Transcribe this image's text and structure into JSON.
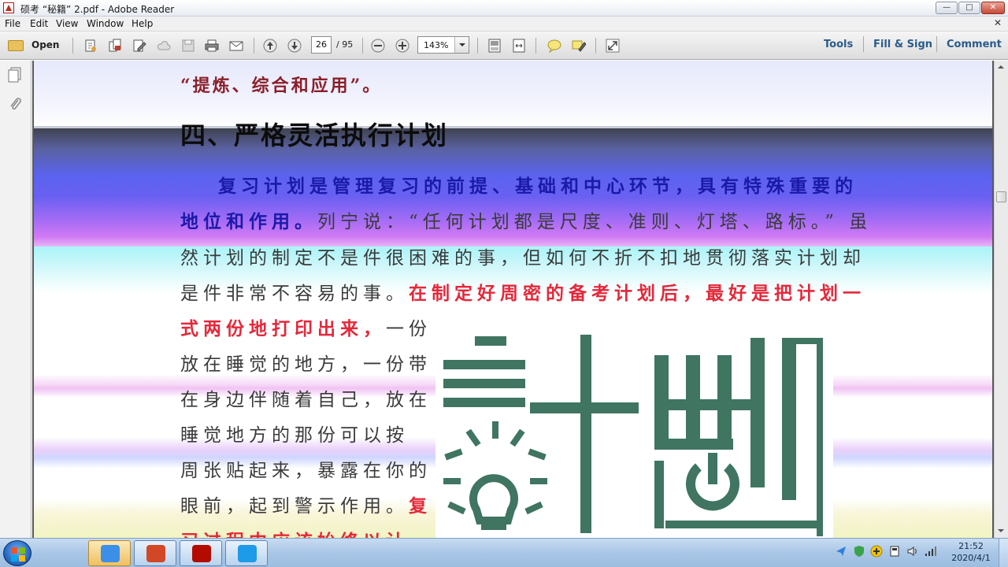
{
  "window": {
    "title": "硕考 “秘籍” 2.pdf - Adobe Reader",
    "controls": {
      "minimize": "—",
      "maximize": "□",
      "close": "✕"
    },
    "doc_close": "✕"
  },
  "menu": [
    "File",
    "Edit",
    "View",
    "Window",
    "Help"
  ],
  "toolbar": {
    "open_label": "Open",
    "current_page": "26",
    "total_pages": "/ 95",
    "zoom": "143%",
    "panels": {
      "tools": "Tools",
      "fill_sign": "Fill & Sign",
      "comment": "Comment"
    },
    "icons": [
      "create-pdf-icon",
      "combine-icon",
      "edit-icon",
      "cloud-icon",
      "save-icon",
      "print-icon",
      "email-icon",
      "previous-page-icon",
      "next-page-icon",
      "zoom-out-icon",
      "zoom-in-icon",
      "fit-page-icon",
      "fit-width-icon",
      "sticky-note-icon",
      "highlight-icon",
      "full-screen-icon"
    ]
  },
  "document": {
    "quote_line": "“提炼、综合和应用”。",
    "heading": "四、严格灵活执行计划",
    "para": {
      "l1_blue": "复习计划是管理复习的前提、基础和中心环节，具有特殊重要的",
      "l2_blue": "地位和作用。",
      "l2_dark": "列宁说：“任何计划都是尺度、准则、灯塔、路标。” 虽",
      "l3_dark": "然计划的制定不是件很困难的事，但如何不折不扣地贯彻落实计划却",
      "l4_dark": "是件非常不容易的事。",
      "l4_red": "在制定好周密的备考计划后，最好是把计划一",
      "l5_red": "式两份地打印出来，",
      "l5_dark": "一份",
      "l6": "放在睡觉的地方，一份带",
      "l7": "在身边伴随着自己，放在",
      "l8": "睡觉地方的那份可以按",
      "l9": "周张贴起来，暴露在你的",
      "l10_dark": "眼前，起到警示作用。",
      "l10_red": "复",
      "l11_red": "习过程中应该始终以计"
    },
    "illustration": {
      "text": "計劃",
      "color": "#3f7561"
    }
  },
  "taskbar": {
    "clock_time": "21:52",
    "clock_date": "2020/4/1",
    "apps": [
      "feishu-icon",
      "powerpoint-icon",
      "adobe-reader-icon",
      "video-app-icon"
    ]
  }
}
